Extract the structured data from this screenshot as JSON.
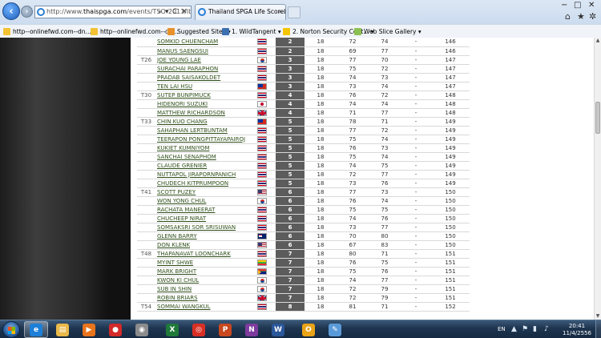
{
  "browser": {
    "url_prefix": "http://www.",
    "url_domain": "thaispga.com",
    "url_rest": "/events/TSO-2013/lb/",
    "tab_title": "Thailand SPGA Life Scorebo...",
    "tab_close": "×",
    "window_controls": [
      "−",
      "□",
      "✕"
    ],
    "chrome_icons": [
      "⌂",
      "★",
      "✲"
    ],
    "address_tools": [
      "⌕",
      "▾",
      "C",
      "✕"
    ],
    "favorites": [
      {
        "label": "http--onlinefwd.com--dn...",
        "color": "#f2c233"
      },
      {
        "label": "http--onlinefwd.com--dn...",
        "color": "#f2c233"
      },
      {
        "label": "Suggested Sites ▾",
        "color": "#e8902a"
      },
      {
        "label": "1. WildTangent ▾",
        "color": "#3b6fb0"
      },
      {
        "label": "2. Norton Security Cent... ▾",
        "color": "#f5c400"
      },
      {
        "label": "Web Slice Gallery ▾",
        "color": "#8cc152"
      }
    ]
  },
  "leaderboard": {
    "rows": [
      {
        "pos": "",
        "name": "SOMKID CHUENCHAM",
        "flag": "thailand",
        "score": "2",
        "r1": "18",
        "r2": "72",
        "r3": "74",
        "r4": "-",
        "total": "146"
      },
      {
        "pos": "",
        "name": "MANUS SAENGSUI",
        "flag": "thailand",
        "score": "2",
        "r1": "18",
        "r2": "69",
        "r3": "77",
        "r4": "-",
        "total": "146"
      },
      {
        "pos": "T26",
        "name": "JOE YOUNG LAE",
        "flag": "korea",
        "score": "3",
        "r1": "18",
        "r2": "77",
        "r3": "70",
        "r4": "-",
        "total": "147"
      },
      {
        "pos": "",
        "name": "SURACHAI PARAPHON",
        "flag": "thailand",
        "score": "3",
        "r1": "18",
        "r2": "75",
        "r3": "72",
        "r4": "-",
        "total": "147"
      },
      {
        "pos": "",
        "name": "PRADAB SAISAKOLDET",
        "flag": "thailand",
        "score": "3",
        "r1": "18",
        "r2": "74",
        "r3": "73",
        "r4": "-",
        "total": "147"
      },
      {
        "pos": "",
        "name": "TEN LAI HSU",
        "flag": "taiwan",
        "score": "3",
        "r1": "18",
        "r2": "73",
        "r3": "74",
        "r4": "-",
        "total": "147"
      },
      {
        "pos": "T30",
        "name": "SUTEP BUNPIMUCK",
        "flag": "thailand",
        "score": "4",
        "r1": "18",
        "r2": "76",
        "r3": "72",
        "r4": "-",
        "total": "148"
      },
      {
        "pos": "",
        "name": "HIDENORI SUZUKI",
        "flag": "japan",
        "score": "4",
        "r1": "18",
        "r2": "74",
        "r3": "74",
        "r4": "-",
        "total": "148"
      },
      {
        "pos": "",
        "name": "MATTHEW RICHARDSON",
        "flag": "uk",
        "score": "4",
        "r1": "18",
        "r2": "71",
        "r3": "77",
        "r4": "-",
        "total": "148"
      },
      {
        "pos": "T33",
        "name": "CHIN KUO CHANG",
        "flag": "taiwan",
        "score": "5",
        "r1": "18",
        "r2": "78",
        "r3": "71",
        "r4": "-",
        "total": "149"
      },
      {
        "pos": "",
        "name": "SAHAPHAN LERTBUNTAM",
        "flag": "thailand",
        "score": "5",
        "r1": "18",
        "r2": "77",
        "r3": "72",
        "r4": "-",
        "total": "149"
      },
      {
        "pos": "",
        "name": "TEERAPON PONGPITTAYAPAIROJ",
        "flag": "thailand",
        "score": "5",
        "r1": "18",
        "r2": "75",
        "r3": "74",
        "r4": "-",
        "total": "149"
      },
      {
        "pos": "",
        "name": "KUKIET KUMNIYOM",
        "flag": "thailand",
        "score": "5",
        "r1": "18",
        "r2": "76",
        "r3": "73",
        "r4": "-",
        "total": "149"
      },
      {
        "pos": "",
        "name": "SANCHAI SENAPHOM",
        "flag": "thailand",
        "score": "5",
        "r1": "18",
        "r2": "75",
        "r3": "74",
        "r4": "-",
        "total": "149"
      },
      {
        "pos": "",
        "name": "CLAUDE GRENIER",
        "flag": "thailand",
        "score": "5",
        "r1": "18",
        "r2": "74",
        "r3": "75",
        "r4": "-",
        "total": "149"
      },
      {
        "pos": "",
        "name": "NUTTAPOL JIRAPORNPANICH",
        "flag": "thailand",
        "score": "5",
        "r1": "18",
        "r2": "72",
        "r3": "77",
        "r4": "-",
        "total": "149"
      },
      {
        "pos": "",
        "name": "CHUDECH KITPRUMPOON",
        "flag": "thailand",
        "score": "5",
        "r1": "18",
        "r2": "73",
        "r3": "76",
        "r4": "-",
        "total": "149"
      },
      {
        "pos": "T41",
        "name": "SCOTT PUZEY",
        "flag": "usa",
        "score": "6",
        "r1": "18",
        "r2": "77",
        "r3": "73",
        "r4": "-",
        "total": "150"
      },
      {
        "pos": "",
        "name": "WON YONG CHUL",
        "flag": "korea",
        "score": "6",
        "r1": "18",
        "r2": "76",
        "r3": "74",
        "r4": "-",
        "total": "150"
      },
      {
        "pos": "",
        "name": "RACHATA MANEERAT",
        "flag": "thailand",
        "score": "6",
        "r1": "18",
        "r2": "75",
        "r3": "75",
        "r4": "-",
        "total": "150"
      },
      {
        "pos": "",
        "name": "CHUCHEEP NIRAT",
        "flag": "thailand",
        "score": "6",
        "r1": "18",
        "r2": "74",
        "r3": "76",
        "r4": "-",
        "total": "150"
      },
      {
        "pos": "",
        "name": "SOMSAKSRI SOR SRISUWAN",
        "flag": "thailand",
        "score": "6",
        "r1": "18",
        "r2": "73",
        "r3": "77",
        "r4": "-",
        "total": "150"
      },
      {
        "pos": "",
        "name": "GLENN BARRY",
        "flag": "australia",
        "score": "6",
        "r1": "18",
        "r2": "70",
        "r3": "80",
        "r4": "-",
        "total": "150"
      },
      {
        "pos": "",
        "name": "DON KLENK",
        "flag": "usa",
        "score": "6",
        "r1": "18",
        "r2": "67",
        "r3": "83",
        "r4": "-",
        "total": "150"
      },
      {
        "pos": "T48",
        "name": "THAPANAVAT LOONCHARK",
        "flag": "thailand",
        "score": "7",
        "r1": "18",
        "r2": "80",
        "r3": "71",
        "r4": "-",
        "total": "151"
      },
      {
        "pos": "",
        "name": "MYINT SHWE",
        "flag": "myanmar",
        "score": "7",
        "r1": "18",
        "r2": "76",
        "r3": "75",
        "r4": "-",
        "total": "151"
      },
      {
        "pos": "",
        "name": "MARK BRIGHT",
        "flag": "south-africa",
        "score": "7",
        "r1": "18",
        "r2": "75",
        "r3": "76",
        "r4": "-",
        "total": "151"
      },
      {
        "pos": "",
        "name": "KWON KI CHUL",
        "flag": "korea",
        "score": "7",
        "r1": "18",
        "r2": "74",
        "r3": "77",
        "r4": "-",
        "total": "151"
      },
      {
        "pos": "",
        "name": "SUB IN SHIN",
        "flag": "korea",
        "score": "7",
        "r1": "18",
        "r2": "72",
        "r3": "79",
        "r4": "-",
        "total": "151"
      },
      {
        "pos": "",
        "name": "ROBIN BRIARS",
        "flag": "uk",
        "score": "7",
        "r1": "18",
        "r2": "72",
        "r3": "79",
        "r4": "-",
        "total": "151"
      },
      {
        "pos": "T54",
        "name": "SOMMAI WANGKUL",
        "flag": "thailand",
        "score": "8",
        "r1": "18",
        "r2": "81",
        "r3": "71",
        "r4": "-",
        "total": "152"
      }
    ]
  },
  "taskbar": {
    "apps": [
      {
        "name": "ie",
        "glyph": "e",
        "color": "#1e7fd8",
        "active": true
      },
      {
        "name": "explorer",
        "glyph": "▤",
        "color": "#e9b94a",
        "active": false
      },
      {
        "name": "media-player",
        "glyph": "▶",
        "color": "#e8741c",
        "active": false
      },
      {
        "name": "pin-app",
        "glyph": "●",
        "color": "#d42a2a",
        "active": false
      },
      {
        "name": "disc-app",
        "glyph": "◉",
        "color": "#8c8c8c",
        "active": false
      },
      {
        "name": "excel",
        "glyph": "X",
        "color": "#1f7a3a",
        "active": false
      },
      {
        "name": "chrome",
        "glyph": "◎",
        "color": "#d93025",
        "active": false
      },
      {
        "name": "powerpoint",
        "glyph": "P",
        "color": "#c8481f",
        "active": false
      },
      {
        "name": "onenote",
        "glyph": "N",
        "color": "#7e3b9e",
        "active": false
      },
      {
        "name": "word",
        "glyph": "W",
        "color": "#2b579a",
        "active": false
      },
      {
        "name": "outlook",
        "glyph": "O",
        "color": "#e8a317",
        "active": false
      },
      {
        "name": "paint",
        "glyph": "✎",
        "color": "#5a9ad8",
        "active": false
      }
    ],
    "language": "EN",
    "tray_icons": [
      "▲",
      "⚑",
      "▮",
      "♪"
    ],
    "time": "20:41",
    "date": "11/4/2556"
  }
}
